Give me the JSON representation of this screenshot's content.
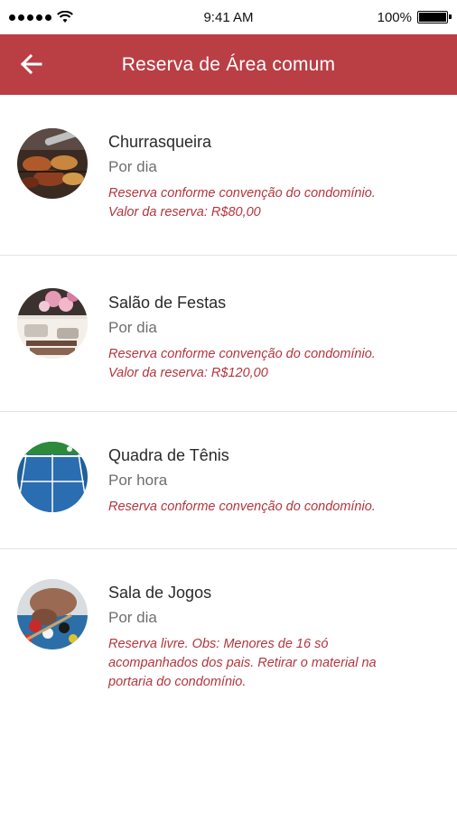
{
  "status": {
    "time": "9:41 AM",
    "battery": "100%",
    "battery_level": 1.0
  },
  "header": {
    "title": "Reserva de Área comum",
    "back_icon": "arrow-left-icon",
    "background": "#b93f45"
  },
  "items": [
    {
      "title": "Churrasqueira",
      "period": "Por dia",
      "note_line1": "Reserva conforme convenção do condomínio.",
      "note_line2": "Valor da reserva: R$80,00",
      "note_line3": ""
    },
    {
      "title": "Salão de Festas",
      "period": "Por dia",
      "note_line1": "Reserva conforme convenção do condomínio.",
      "note_line2": "Valor da reserva: R$120,00",
      "note_line3": ""
    },
    {
      "title": "Quadra de Tênis",
      "period": "Por hora",
      "note_line1": "Reserva conforme convenção do condomínio.",
      "note_line2": "",
      "note_line3": ""
    },
    {
      "title": "Sala de Jogos",
      "period": "Por dia",
      "note_line1": "Reserva livre. Obs: Menores de 16 só",
      "note_line2": "acompanhados dos pais. Retirar o material na",
      "note_line3": "portaria do condomínio."
    }
  ]
}
